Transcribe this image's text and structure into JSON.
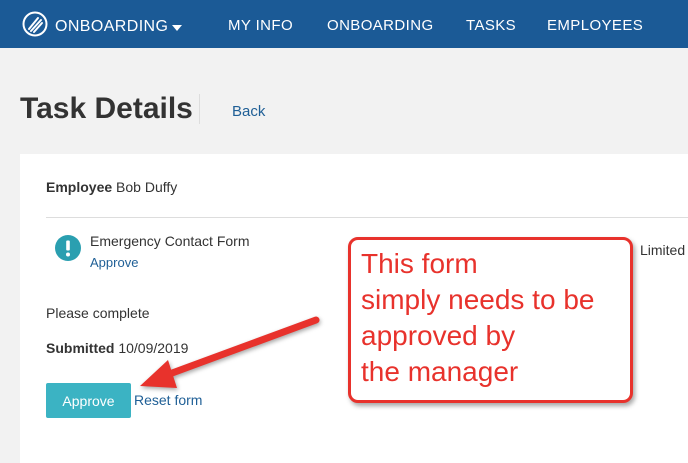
{
  "nav": {
    "brand_label": "ONBOARDING",
    "items": [
      {
        "label": "MY INFO"
      },
      {
        "label": "ONBOARDING"
      },
      {
        "label": "TASKS"
      },
      {
        "label": "EMPLOYEES"
      }
    ],
    "background": "#1b5a96"
  },
  "header": {
    "title": "Task Details",
    "back_label": "Back"
  },
  "task": {
    "employee_label": "Employee",
    "employee_name": "Bob Duffy",
    "form_name": "Emergency Contact Form",
    "form_approve_link": "Approve",
    "status_partial": "Limited",
    "instructions": "Please complete",
    "submitted_label": "Submitted",
    "submitted_date": "10/09/2019",
    "approve_button": "Approve",
    "reset_link": "Reset form"
  },
  "annotation": {
    "lines": [
      "This form",
      "simply needs to be",
      "approved by",
      "the manager"
    ],
    "color": "#e8322c"
  },
  "colors": {
    "accent_button": "#3bb3c3",
    "link": "#1f5f96",
    "alert_icon": "#2a9fb0"
  }
}
